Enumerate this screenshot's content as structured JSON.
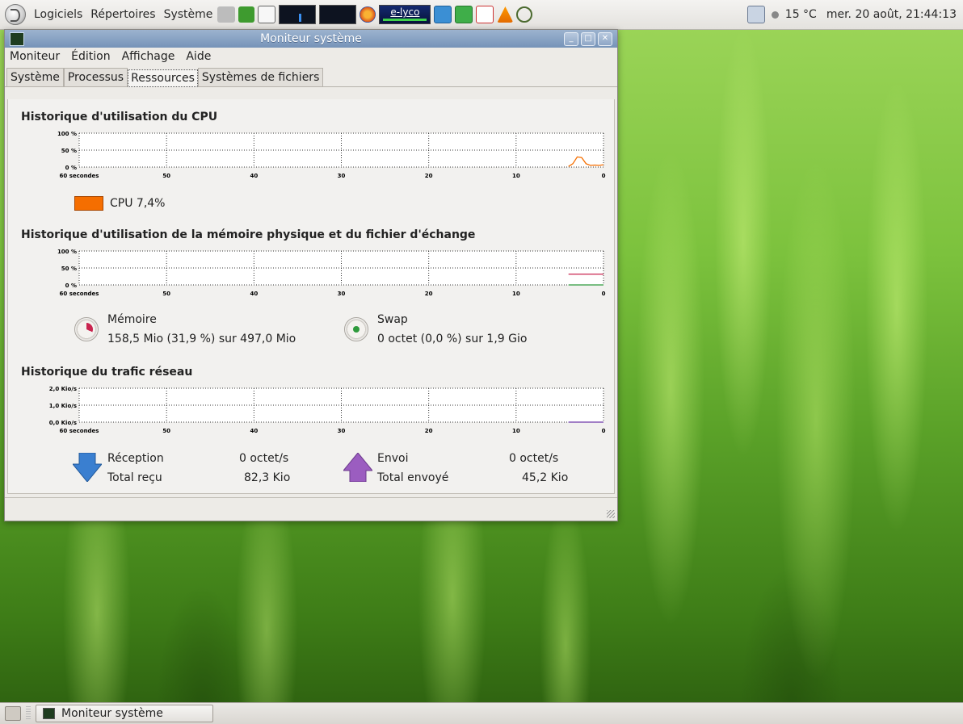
{
  "top_panel": {
    "menus": [
      "Logiciels",
      "Répertoires",
      "Système"
    ],
    "tray_label": "e-lyco",
    "weather": "15 °C",
    "clock": "mer. 20 août, 21:44:13"
  },
  "window": {
    "title": "Moniteur système",
    "menubar": [
      "Moniteur",
      "Édition",
      "Affichage",
      "Aide"
    ],
    "tabs": [
      "Système",
      "Processus",
      "Ressources",
      "Systèmes de fichiers"
    ],
    "active_tab": "Ressources",
    "cpu": {
      "title": "Historique d'utilisation du CPU",
      "legend": "CPU 7,4%",
      "color": "#f56e00"
    },
    "memory": {
      "title": "Historique d'utilisation de la mémoire physique et du fichier d'échange",
      "mem_label": "Mémoire",
      "mem_value": "158,5 Mio (31,9 %) sur 497,0 Mio",
      "swap_label": "Swap",
      "swap_value": "0 octet (0,0 %) sur 1,9 Gio",
      "mem_color": "#c9244f",
      "swap_color": "#2e9a3c"
    },
    "network": {
      "title": "Historique du trafic réseau",
      "rx_label": "Réception",
      "rx_value": "0 octet/s",
      "rx_total_label": "Total reçu",
      "rx_total_value": "82,3 Kio",
      "tx_label": "Envoi",
      "tx_value": "0 octet/s",
      "tx_total_label": "Total envoyé",
      "tx_total_value": "45,2 Kio"
    }
  },
  "taskbar": {
    "window_button": "Moniteur système"
  },
  "chart_data": [
    {
      "type": "line",
      "title": "Historique d'utilisation du CPU",
      "x_ticks": [
        "60 secondes",
        "50",
        "40",
        "30",
        "20",
        "10",
        "0"
      ],
      "y_ticks": [
        "100 %",
        "50 %",
        "0 %"
      ],
      "ylim": [
        0,
        100
      ],
      "series": [
        {
          "name": "CPU",
          "color": "#f56e00",
          "x": [
            4,
            3.5,
            3,
            2.5,
            2,
            1.5,
            1,
            0.5,
            0
          ],
          "y": [
            2,
            10,
            30,
            28,
            10,
            5,
            6,
            5,
            7
          ]
        }
      ]
    },
    {
      "type": "line",
      "title": "Historique d'utilisation de la mémoire physique et du fichier d'échange",
      "x_ticks": [
        "60 secondes",
        "50",
        "40",
        "30",
        "20",
        "10",
        "0"
      ],
      "y_ticks": [
        "100 %",
        "50 %",
        "0 %"
      ],
      "ylim": [
        0,
        100
      ],
      "series": [
        {
          "name": "Mémoire",
          "color": "#c9244f",
          "x": [
            4,
            0
          ],
          "y": [
            31.9,
            31.9
          ]
        },
        {
          "name": "Swap",
          "color": "#2e9a3c",
          "x": [
            4,
            0
          ],
          "y": [
            0,
            0
          ]
        }
      ]
    },
    {
      "type": "line",
      "title": "Historique du trafic réseau",
      "x_ticks": [
        "60 secondes",
        "50",
        "40",
        "30",
        "20",
        "10",
        "0"
      ],
      "y_ticks": [
        "2,0 Kio/s",
        "1,0 Kio/s",
        "0,0 Kio/s"
      ],
      "ylim": [
        0,
        2
      ],
      "series": [
        {
          "name": "Réception",
          "color": "#3a7fd0",
          "x": [
            4,
            0
          ],
          "y": [
            0,
            0
          ]
        },
        {
          "name": "Envoi",
          "color": "#8c4bb0",
          "x": [
            4,
            0
          ],
          "y": [
            0,
            0
          ]
        }
      ]
    }
  ]
}
